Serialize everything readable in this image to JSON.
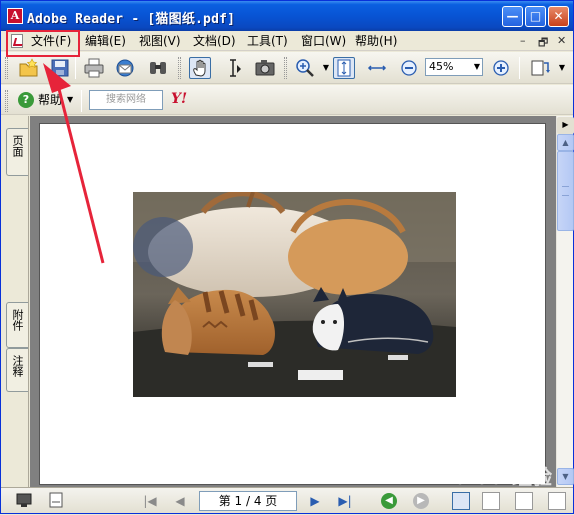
{
  "window": {
    "title": "Adobe Reader - [猫图纸.pdf]",
    "min_glyph": "—",
    "max_glyph": "□",
    "close_glyph": "✕"
  },
  "menu": {
    "items": [
      "文件(F)",
      "编辑(E)",
      "视图(V)",
      "文档(D)",
      "工具(T)",
      "窗口(W)",
      "帮助(H)"
    ],
    "right_controls": [
      "–",
      "🗗",
      "✕"
    ]
  },
  "toolbar": {
    "zoom_value": "45%",
    "help_label": "帮助",
    "search_placeholder": "搜索网络",
    "yahoo_label": "Y!"
  },
  "side_tabs": [
    "页面",
    "附件",
    "注释"
  ],
  "navigation": {
    "page_display": "第 1 / 4 页"
  },
  "watermark": "Baidu 经验",
  "colors": {
    "annotation": "#e6243a",
    "titlebar": "#0854d4"
  }
}
